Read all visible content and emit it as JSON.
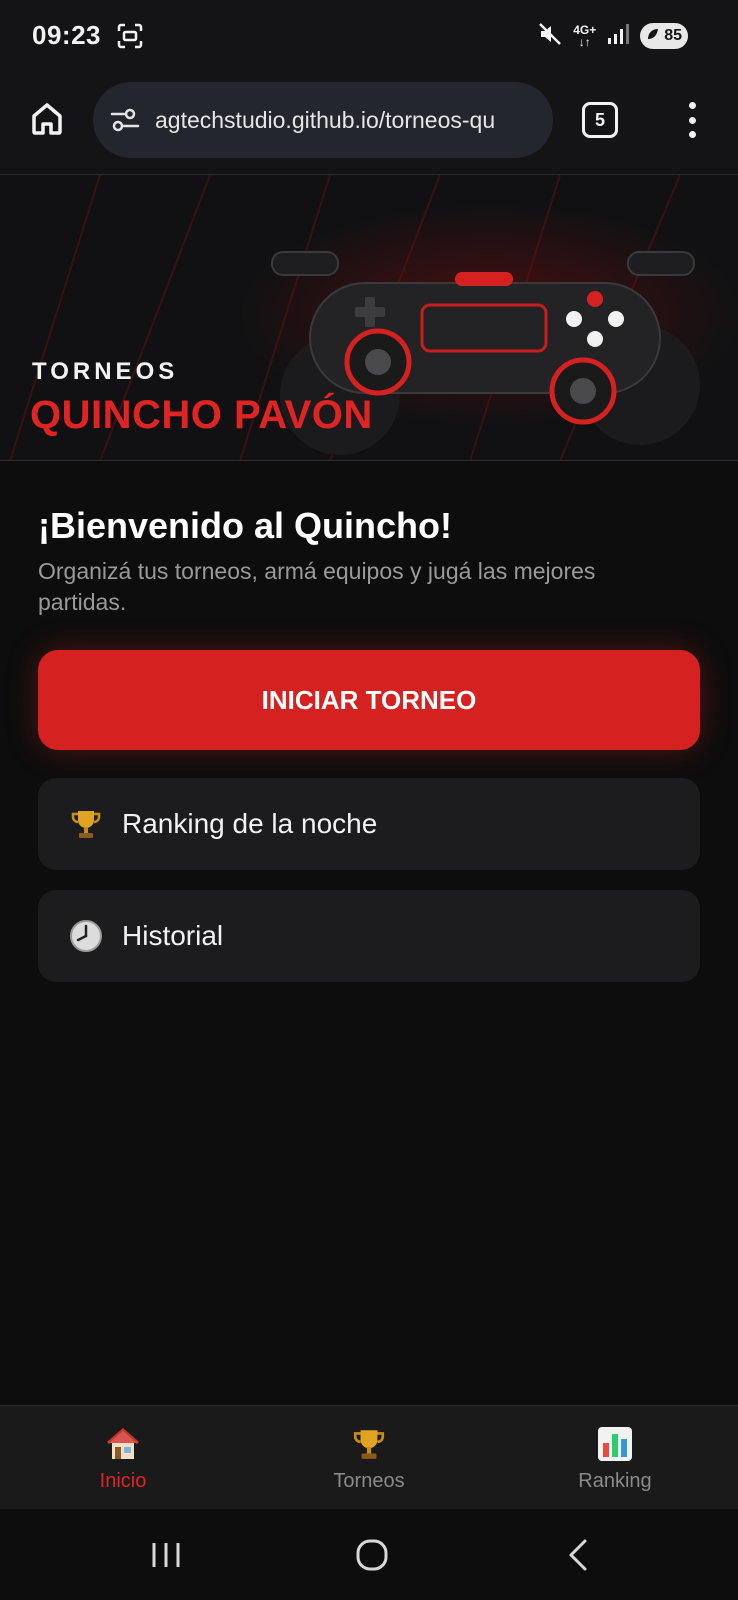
{
  "status_bar": {
    "time": "09:23",
    "network": "4G+",
    "battery": "85"
  },
  "browser": {
    "url": "agtechstudio.github.io/torneos-qu",
    "tab_count": "5"
  },
  "hero": {
    "kicker": "TORNEOS",
    "title": "QUINCHO PAVÓN"
  },
  "main": {
    "welcome_title": "¡Bienvenido al Quincho!",
    "welcome_subtitle": "Organizá tus torneos, armá equipos y jugá las mejores partidas.",
    "start_button": "INICIAR TORNEO",
    "menu": [
      {
        "label": "Ranking de la noche",
        "icon": "trophy-icon"
      },
      {
        "label": "Historial",
        "icon": "clock-icon"
      }
    ]
  },
  "bottom_nav": {
    "items": [
      {
        "label": "Inicio",
        "icon": "house-icon",
        "active": true
      },
      {
        "label": "Torneos",
        "icon": "trophy-icon",
        "active": false
      },
      {
        "label": "Ranking",
        "icon": "bar-chart-icon",
        "active": false
      }
    ]
  },
  "colors": {
    "accent": "#d62121",
    "background": "#0d0d0d",
    "card": "#1c1c1e"
  }
}
